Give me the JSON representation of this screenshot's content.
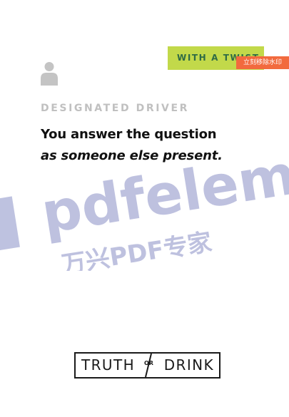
{
  "tag": {
    "label": "WITH A TWIST"
  },
  "watermark": {
    "remove_button": "立刻移除水印",
    "brand_text": "pdfeleme",
    "cn_text": "万兴PDF专家"
  },
  "card": {
    "category": "DESIGNATED DRIVER",
    "prompt_line1": "You answer the question",
    "prompt_line2": "as someone else present."
  },
  "logo": {
    "truth": "TRUTH",
    "or": "OR",
    "drink": "DRINK"
  },
  "colors": {
    "tag_bg": "#c2d94a",
    "tag_text": "#2f6b45",
    "watermark_button": "#f26a3e",
    "watermark_tint": "#b3b7da",
    "category_text": "#c0c0c0"
  },
  "icons": {
    "person": "person-icon"
  }
}
